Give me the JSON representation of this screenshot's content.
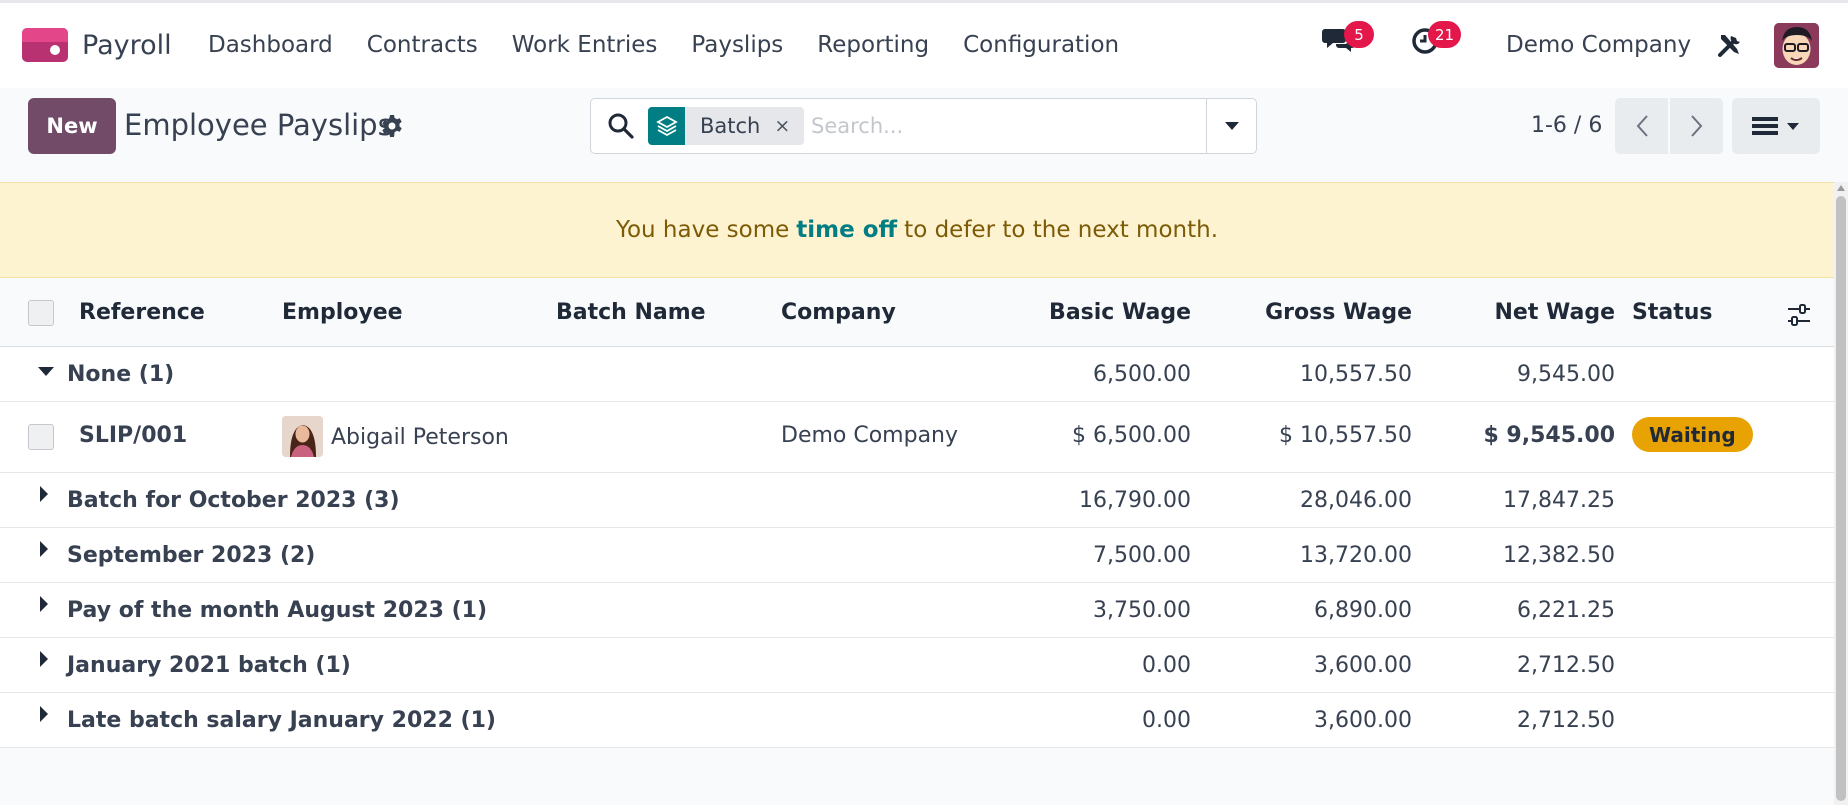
{
  "app": {
    "name": "Payroll"
  },
  "nav": {
    "items": [
      "Dashboard",
      "Contracts",
      "Work Entries",
      "Payslips",
      "Reporting",
      "Configuration"
    ]
  },
  "systray": {
    "messages_count": "5",
    "activities_count": "21",
    "company": "Demo Company"
  },
  "control": {
    "new_label": "New",
    "title": "Employee Payslips",
    "facet_label": "Batch",
    "facet_remove": "×",
    "search_placeholder": "Search...",
    "pager": "1-6 / 6"
  },
  "alert": {
    "before": "You have some",
    "link": "time off",
    "after": "to defer to the next month."
  },
  "table": {
    "headers": {
      "reference": "Reference",
      "employee": "Employee",
      "batch_name": "Batch Name",
      "company": "Company",
      "basic_wage": "Basic Wage",
      "gross_wage": "Gross Wage",
      "net_wage": "Net Wage",
      "status": "Status"
    },
    "groups": [
      {
        "title": "None (1)",
        "basic": "6,500.00",
        "gross": "10,557.50",
        "net": "9,545.00",
        "expanded": true
      },
      {
        "title": "Batch for October 2023 (3)",
        "basic": "16,790.00",
        "gross": "28,046.00",
        "net": "17,847.25",
        "expanded": false
      },
      {
        "title": "September 2023 (2)",
        "basic": "7,500.00",
        "gross": "13,720.00",
        "net": "12,382.50",
        "expanded": false
      },
      {
        "title": "Pay of the month August 2023 (1)",
        "basic": "3,750.00",
        "gross": "6,890.00",
        "net": "6,221.25",
        "expanded": false
      },
      {
        "title": "January 2021 batch (1)",
        "basic": "0.00",
        "gross": "3,600.00",
        "net": "2,712.50",
        "expanded": false
      },
      {
        "title": "Late batch salary January 2022 (1)",
        "basic": "0.00",
        "gross": "3,600.00",
        "net": "2,712.50",
        "expanded": false
      }
    ],
    "record": {
      "reference": "SLIP/001",
      "employee": "Abigail Peterson",
      "batch_name": "",
      "company": "Demo Company",
      "basic": "$ 6,500.00",
      "gross": "$ 10,557.50",
      "net": "$ 9,545.00",
      "status": "Waiting"
    }
  },
  "colors": {
    "brand": "#714b67",
    "accent_teal": "#017e84",
    "status_waiting": "#e8a202",
    "badge_red": "#e3174a",
    "alert_bg": "#fdf3d0"
  }
}
